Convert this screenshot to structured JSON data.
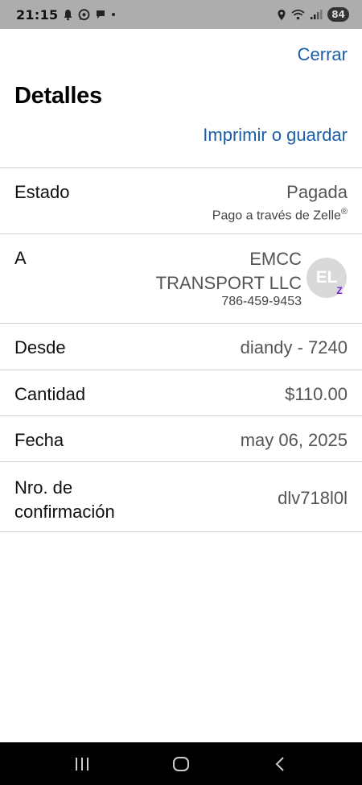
{
  "status_bar": {
    "time": "21:15",
    "battery": "84"
  },
  "header": {
    "close_label": "Cerrar",
    "title": "Detalles",
    "print_label": "Imprimir o guardar"
  },
  "details": {
    "estado": {
      "label": "Estado",
      "value": "Pagada",
      "sub": "Pago a través de Zelle",
      "sub_mark": "®"
    },
    "a": {
      "label": "A",
      "name_line1": "EMCC",
      "name_line2": "TRANSPORT LLC",
      "phone": "786-459-9453",
      "avatar_initials": "EL",
      "badge": "Z"
    },
    "desde": {
      "label": "Desde",
      "value": "diandy - 7240"
    },
    "cantidad": {
      "label": "Cantidad",
      "value": "$110.00"
    },
    "fecha": {
      "label": "Fecha",
      "value": "may 06, 2025"
    },
    "confirmacion": {
      "label_line1": "Nro. de",
      "label_line2": "confirmación",
      "value": "dlv718l0l"
    }
  },
  "icons": {
    "status_left": [
      "bell-icon",
      "whatsapp-icon",
      "chat-icon",
      "dot-icon"
    ],
    "status_right": [
      "location-icon",
      "wifi-icon",
      "signal-icon",
      "battery-icon"
    ],
    "nav": [
      "recents-icon",
      "home-icon",
      "back-icon"
    ]
  },
  "colors": {
    "link": "#1c5fa8",
    "status_bar_bg": "#adadad",
    "zelle_purple": "#6d1ed4",
    "divider": "#cfcfcf"
  }
}
